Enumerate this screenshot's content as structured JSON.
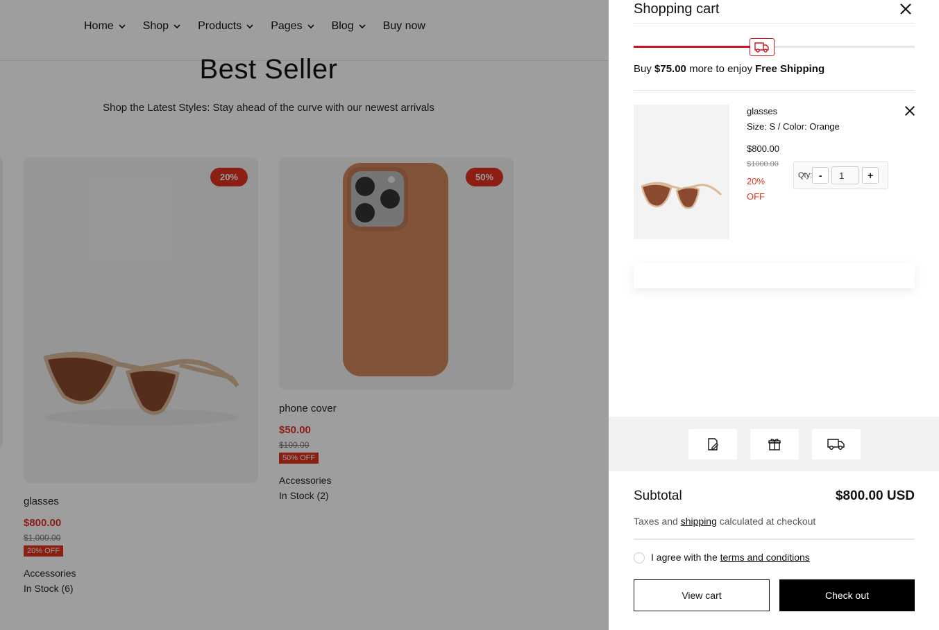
{
  "nav": {
    "items": [
      {
        "label": "Home",
        "has_dropdown": true
      },
      {
        "label": "Shop",
        "has_dropdown": true
      },
      {
        "label": "Products",
        "has_dropdown": true
      },
      {
        "label": "Pages",
        "has_dropdown": true
      },
      {
        "label": "Blog",
        "has_dropdown": true
      },
      {
        "label": "Buy now",
        "has_dropdown": false
      }
    ]
  },
  "section": {
    "title": "Best Seller",
    "subtitle": "Shop the Latest Styles: Stay ahead of the curve with our newest arrivals"
  },
  "products": [
    {
      "badge": "20%",
      "name": "glasses",
      "price": "$800.00",
      "was": "$1,000.00",
      "off": "20% OFF",
      "category": "Accessories",
      "stock": "In Stock (6)",
      "image_icon": "sunglasses-image"
    },
    {
      "badge": "50%",
      "name": "phone cover",
      "price": "$50.00",
      "was": "$100.00",
      "off": "50% OFF",
      "category": "Accessories",
      "stock": "In Stock (2)",
      "image_icon": "phone-case-image"
    }
  ],
  "cart": {
    "title": "Shopping cart",
    "shipping_progress": 0.42,
    "shipping_msg_prefix": "Buy ",
    "shipping_amount": "$75.00",
    "shipping_msg_mid": " more to enjoy ",
    "shipping_goal": "Free Shipping",
    "item": {
      "name": "glasses",
      "variant": "Size: S / Color: Orange",
      "price": "$800.00",
      "was": "$1000.00",
      "off": "20% OFF",
      "qty_label": "Qty:",
      "qty_minus": "-",
      "qty_value": "1",
      "qty_plus": "+"
    },
    "tools": [
      "note-icon",
      "gift-icon",
      "truck-icon"
    ],
    "subtotal_label": "Subtotal",
    "subtotal_value": "$800.00 USD",
    "tax_prefix": "Taxes and ",
    "tax_link": "shipping",
    "tax_suffix": " calculated at checkout",
    "agree_prefix": "I agree with the ",
    "agree_link": "terms and conditions",
    "view_cart": "View cart",
    "checkout": "Check out"
  },
  "colors": {
    "accent_red": "#e0331f",
    "progress_red": "#d0121b",
    "checkout_bg": "#000000"
  }
}
